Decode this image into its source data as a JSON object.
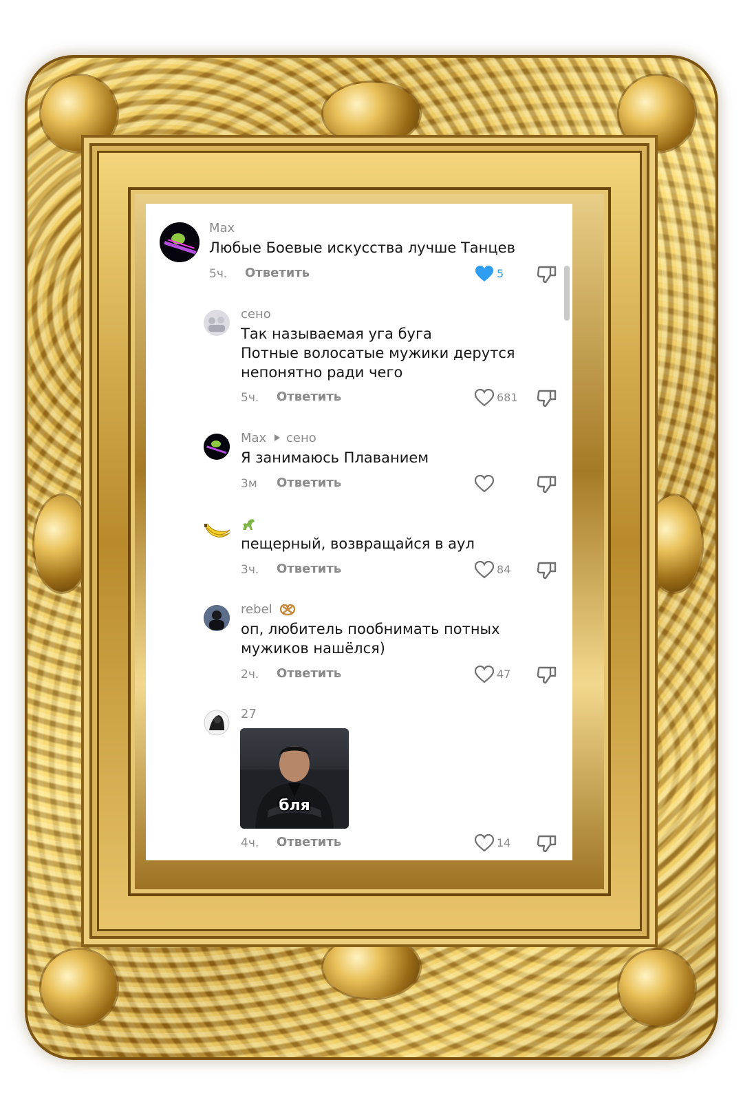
{
  "comments": [
    {
      "author": "Max",
      "text": "Любые Боевые искусства лучше Танцев",
      "time": "5ч.",
      "reply": "Ответить",
      "likes": "5",
      "liked": true
    },
    {
      "author": "сено",
      "text": "Так называемая уга буга\nПотные волосатые мужики дерутся\nнепонятно ради чего",
      "time": "5ч.",
      "reply": "Ответить",
      "likes": "681"
    },
    {
      "author": "Max",
      "reply_to": "сено",
      "text": "Я занимаюсь Плаванием",
      "time": "3м",
      "reply": "Ответить",
      "likes": ""
    },
    {
      "author": "",
      "text": "пещерный, возвращайся в аул",
      "time": "3ч.",
      "reply": "Ответить",
      "likes": "84"
    },
    {
      "author": "rebel",
      "text": "оп, любитель пообнимать потных\nмужиков нашёлся)",
      "time": "2ч.",
      "reply": "Ответить",
      "likes": "47"
    },
    {
      "author": "27",
      "media_caption": "бля",
      "time": "4ч.",
      "reply": "Ответить",
      "likes": "14"
    }
  ],
  "colors": {
    "like_active": "#2f9ef0",
    "muted_text": "#8a8a8a",
    "frame_gold": "#c89a3a"
  },
  "icons": {
    "like": "heart-icon",
    "dislike": "dislike-icon",
    "reply_arrow": "play-arrow-icon",
    "banana": "banana-icon",
    "dinosaur": "dinosaur-icon",
    "pretzel": "pretzel-icon"
  }
}
